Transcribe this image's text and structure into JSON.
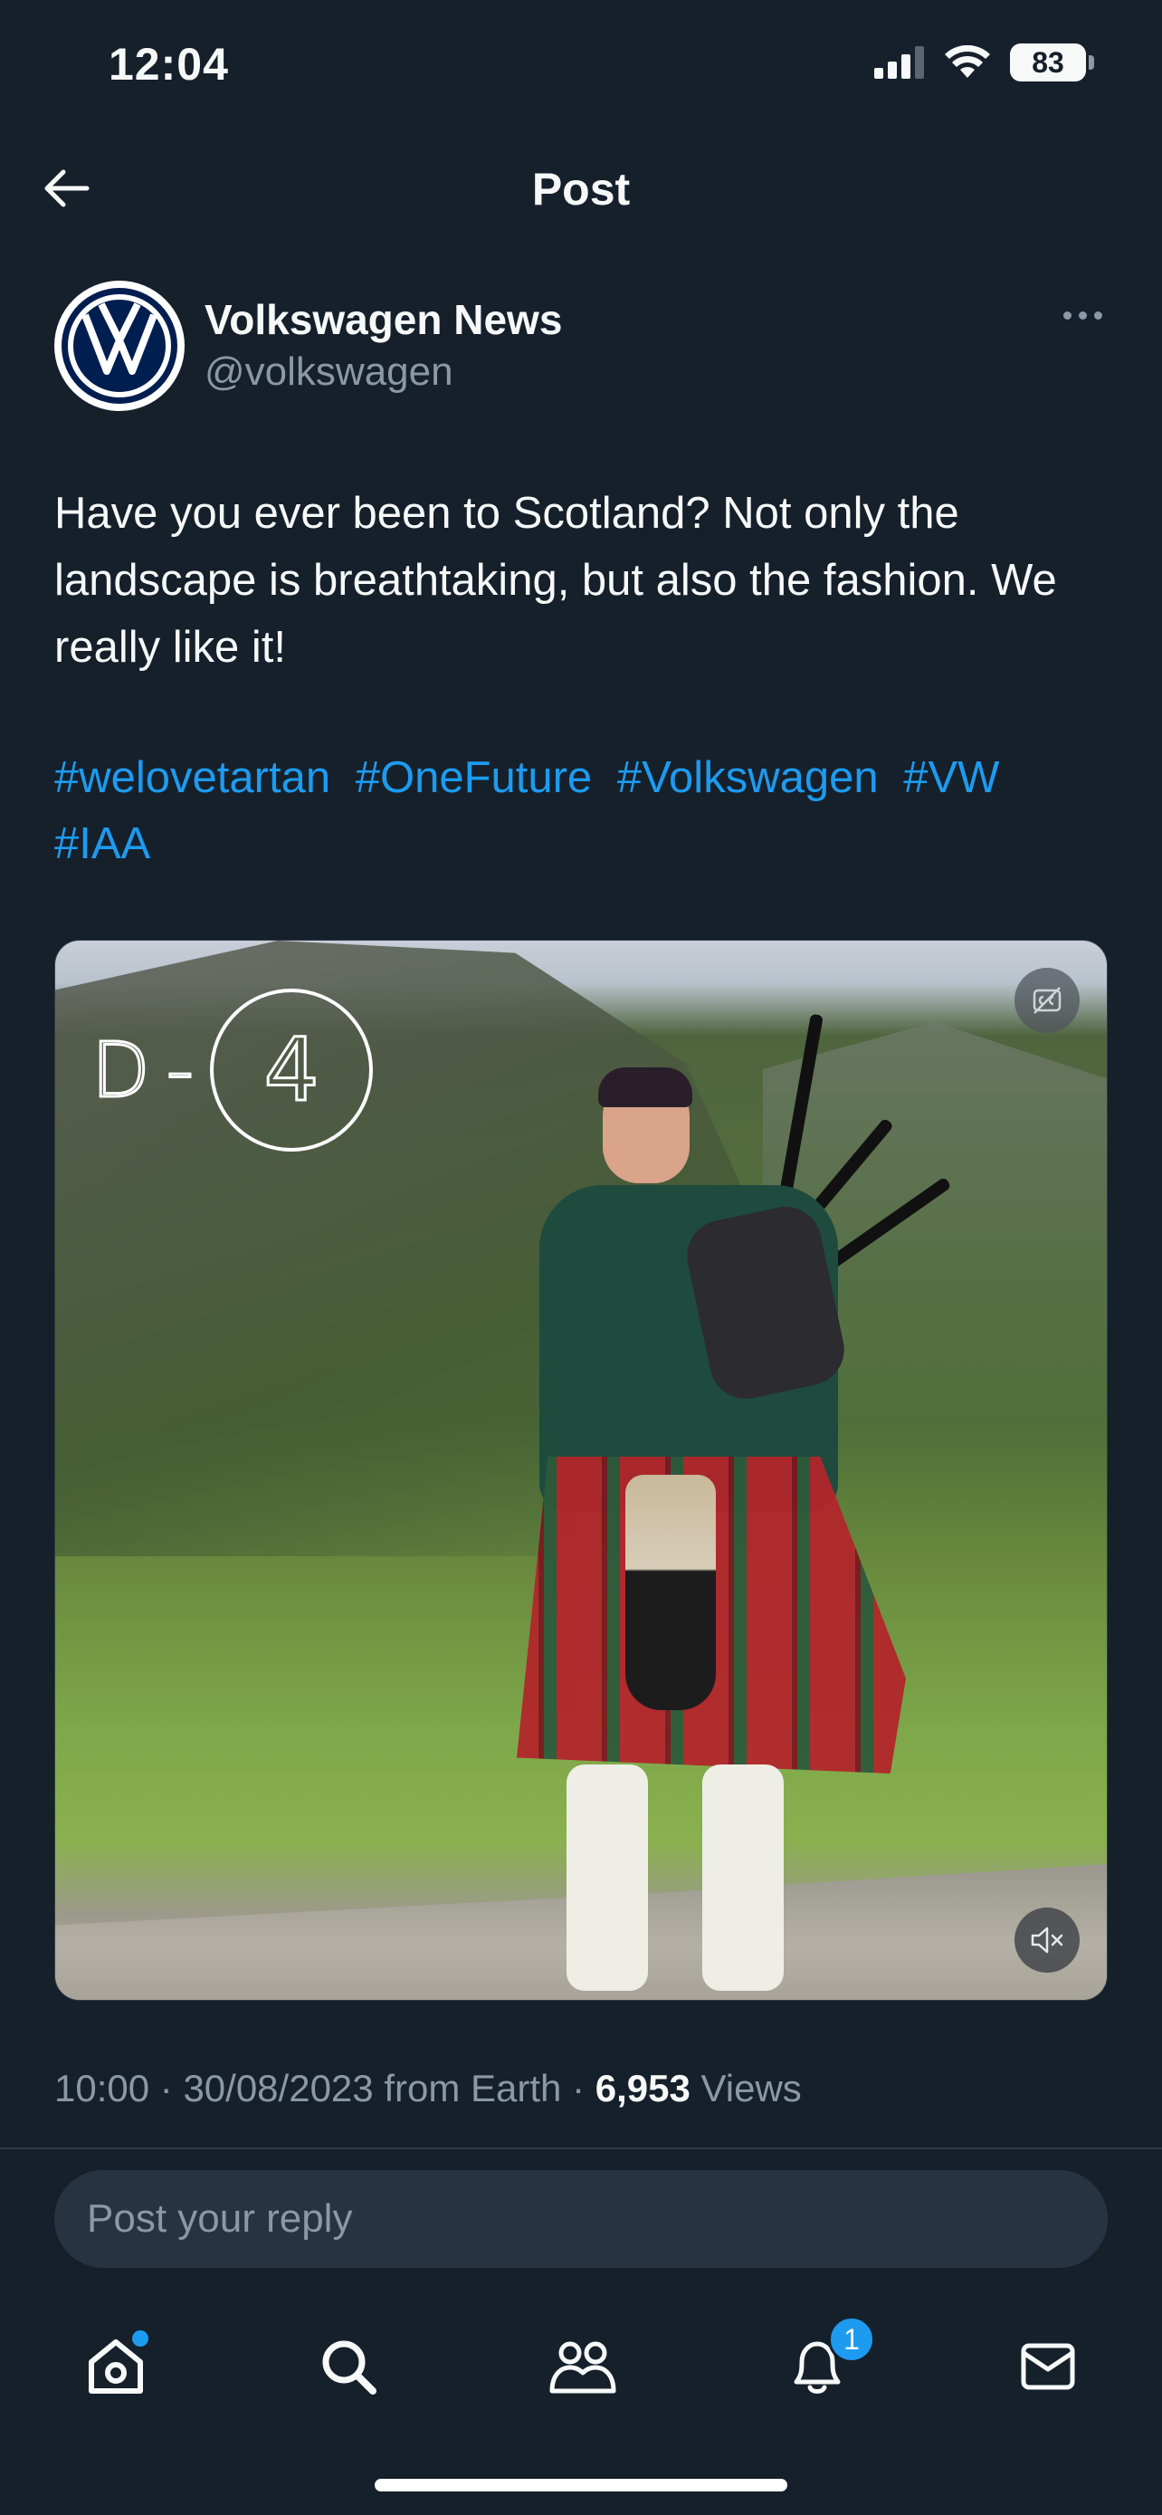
{
  "status_bar": {
    "time": "12:04",
    "battery": "83"
  },
  "header": {
    "title": "Post"
  },
  "author": {
    "name": "Volkswagen News",
    "handle": "@volkswagen"
  },
  "post": {
    "text": "Have you ever been to Scotland? Not only the landscape is breathtaking, but also the fashion. We really like it!",
    "hashtags": [
      "#welovetartan",
      "#OneFuture",
      "#Volkswagen",
      "#VW",
      "#IAA"
    ]
  },
  "media": {
    "overlay_letter": "D",
    "overlay_dash": "-",
    "overlay_number": "4"
  },
  "meta": {
    "time": "10:00",
    "date": "30/08/2023",
    "source": "from Earth",
    "views_count": "6,953",
    "views_label": "Views"
  },
  "reply": {
    "placeholder": "Post your reply"
  },
  "tabbar": {
    "notifications_badge": "1"
  },
  "colors": {
    "background": "#15202b",
    "accent": "#1d9bf0",
    "secondary_text": "#8b98a5"
  },
  "icons": [
    "back-arrow-icon",
    "more-icon",
    "captions-icon",
    "mute-icon",
    "home-icon",
    "search-icon",
    "communities-icon",
    "notifications-icon",
    "messages-icon"
  ]
}
